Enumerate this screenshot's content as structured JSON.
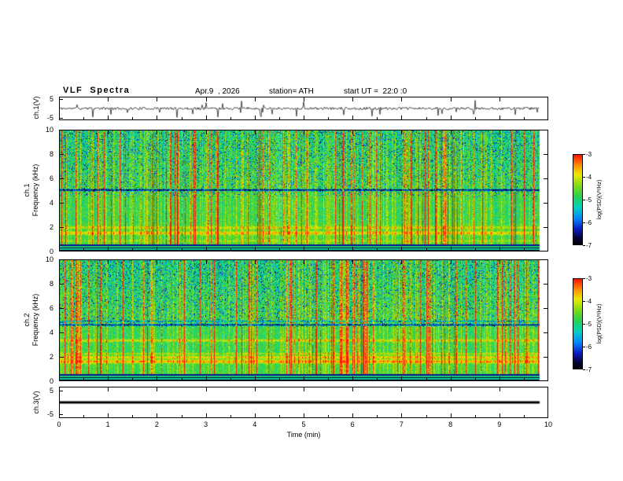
{
  "header": {
    "title": "VLF  Spectra",
    "date": "Apr.9  , 2026",
    "station": "station= ATH",
    "start_ut": "start UT =  22:0 :0"
  },
  "xaxis": {
    "label": "Time  (min)",
    "ticks": [
      0,
      1,
      2,
      3,
      4,
      5,
      6,
      7,
      8,
      9,
      10
    ],
    "range": [
      0,
      10
    ]
  },
  "chart_data": [
    {
      "id": "ch1_waveform",
      "type": "line",
      "ylabel": "ch.1(V)",
      "ylim": [
        -5,
        5
      ],
      "yticks": [
        5,
        -5
      ],
      "x_range_min": [
        0,
        10
      ],
      "signal": "broadband VLF noise waveform, mean 0 V, rms ~0.8 V, dense impulsive sferic spikes reaching about +/-5 V throughout 0-10 min"
    },
    {
      "id": "ch1_spectrogram",
      "type": "heatmap",
      "ylabel_line1": "ch.1",
      "ylabel_line2": "Frequency (kHz)",
      "ylim": [
        0,
        10
      ],
      "yticks": [
        0,
        2,
        4,
        6,
        8,
        10
      ],
      "xlim": [
        0,
        10
      ],
      "colorbar": {
        "label": "log(PSD)(V²/Hz)",
        "ticks": [
          -3,
          -4,
          -5,
          -6,
          -7
        ],
        "min": -7,
        "max": -3
      },
      "features": {
        "background_log_psd": -4.7,
        "dark_bands_kHz": [
          [
            0,
            0.35
          ]
        ],
        "bright_bands_kHz": [
          0.9,
          1.5,
          2.0
        ],
        "persistent_dark_line_kHz": 5.1,
        "blue_speckle_region_kHz": [
          5,
          10
        ],
        "vertical_sferic_stripes": "dense full-band yellow/red columns up to log PSD -3, roughly every few seconds",
        "data_end_min": 9.8
      }
    },
    {
      "id": "ch2_spectrogram",
      "type": "heatmap",
      "ylabel_line1": "ch.2",
      "ylabel_line2": "Frequency (kHz)",
      "ylim": [
        0,
        10
      ],
      "yticks": [
        0,
        2,
        4,
        6,
        8,
        10
      ],
      "xlim": [
        0,
        10
      ],
      "colorbar": {
        "label": "log(PSD)(V²/Hz)",
        "ticks": [
          -3,
          -4,
          -5,
          -6,
          -7
        ],
        "min": -7,
        "max": -3
      },
      "features": {
        "background_log_psd": -4.7,
        "dark_bands_kHz": [
          [
            0,
            0.35
          ]
        ],
        "bright_bands_kHz": [
          1.6,
          2.0,
          2.25,
          3.35
        ],
        "persistent_dark_line_kHz": 4.65,
        "blue_speckle_region_kHz": [
          5,
          10
        ],
        "vertical_sferic_stripes": "dense full-band yellow/red columns up to log PSD -3",
        "data_end_min": 9.8
      }
    },
    {
      "id": "ch3_waveform",
      "type": "line",
      "ylabel": "ch.3(V)",
      "ylim": [
        -5,
        5
      ],
      "yticks": [
        5,
        -5
      ],
      "signal": "constant 0 V flat thick line (channel inactive) from 0 to 9.8 min"
    }
  ]
}
